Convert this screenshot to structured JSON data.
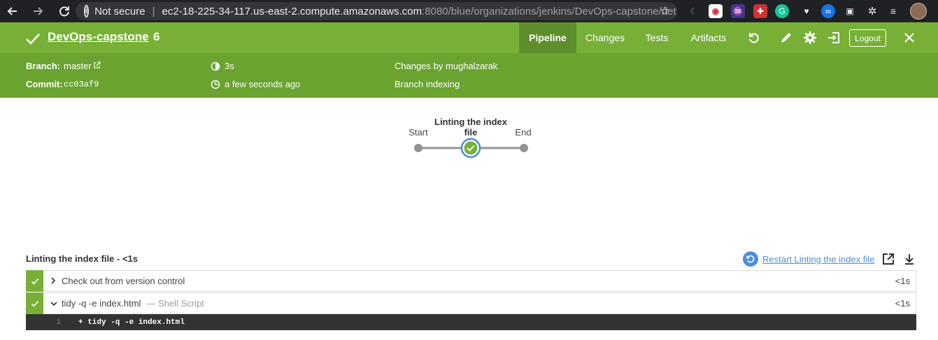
{
  "browser": {
    "security_label": "Not secure",
    "url_host": "ec2-18-225-34-117.us-east-2.compute.amazonaws.com",
    "url_path": ":8080/blue/organizations/jenkins/DevOps-capstone/det..."
  },
  "header": {
    "project": "DevOps-capstone",
    "run_number": "6",
    "tabs": [
      {
        "label": "Pipeline",
        "active": true
      },
      {
        "label": "Changes",
        "active": false
      },
      {
        "label": "Tests",
        "active": false
      },
      {
        "label": "Artifacts",
        "active": false
      }
    ],
    "logout_label": "Logout"
  },
  "meta": {
    "branch_label": "Branch:",
    "branch_value": "master",
    "commit_label": "Commit:",
    "commit_value": "cc03af9",
    "duration": "3s",
    "time_ago": "a few seconds ago",
    "changes": "Changes by mughalzarak",
    "cause": "Branch indexing"
  },
  "pipeline": {
    "start_label": "Start",
    "stage_label_line1": "Linting the index",
    "stage_label_line2": "file",
    "end_label": "End"
  },
  "stage_detail": {
    "title": "Linting the index file - <1s",
    "restart_label": "Restart Linting the index file",
    "steps": [
      {
        "name": "Check out from version control",
        "sub": "",
        "duration": "<1s",
        "expanded": false
      },
      {
        "name": "tidy -q -e index.html",
        "sub": "— Shell Script",
        "duration": "<1s",
        "expanded": true
      }
    ],
    "console": {
      "line_number": "1",
      "text": "+ tidy -q -e index.html"
    }
  },
  "colors": {
    "header_green": "#78b037",
    "meta_green": "#6aa330",
    "active_tab": "#5e8f2c",
    "link_blue": "#4a90d9",
    "console_bg": "#333333"
  }
}
